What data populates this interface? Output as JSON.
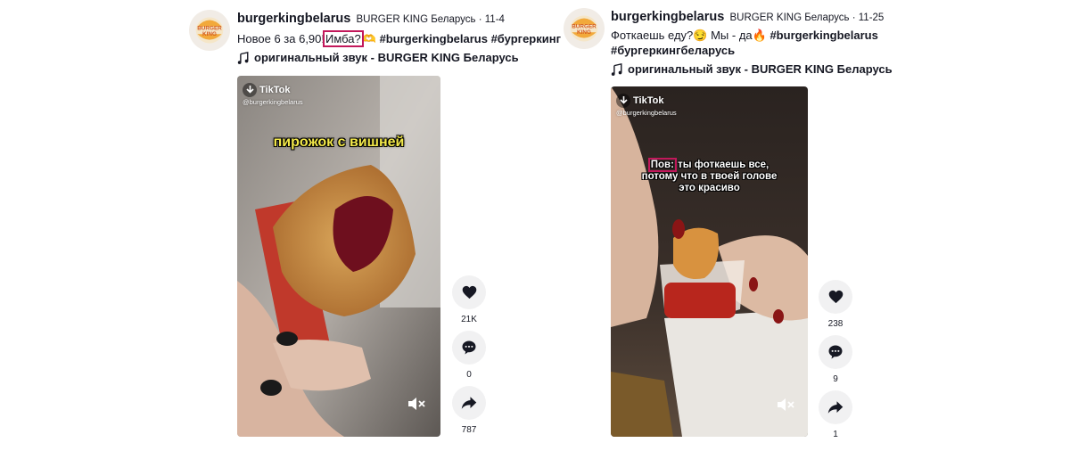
{
  "posts": [
    {
      "username": "burgerkingbelarus",
      "nickname": "BURGER KING Беларусь",
      "date": "11-4",
      "caption_before": "Новое 6 за 6,90!",
      "caption_highlight": "Имба?",
      "caption_emoji": "🫶",
      "hashtags": [
        "#burgerkingbelarus",
        "#бургеркинг"
      ],
      "music": "оригинальный звук - BURGER KING Беларусь",
      "watermark": "TikTok",
      "watermark_handle": "@burgerkingbelarus",
      "overlay_text": "пирожок с вишней",
      "likes": "21K",
      "comments": "0",
      "shares": "787"
    },
    {
      "username": "burgerkingbelarus",
      "nickname": "BURGER KING Беларусь",
      "date": "11-25",
      "caption_text": "Фоткаешь еду?😏 Мы - да🔥",
      "hashtags": [
        "#burgerkingbelarus",
        "#бургеркингбеларусь"
      ],
      "music": "оригинальный звук - BURGER KING Беларусь",
      "watermark": "TikTok",
      "watermark_handle": "@burgerkingbelarus",
      "overlay_highlight": "Пов:",
      "overlay_line1_rest": " ты фоткаешь все,",
      "overlay_line2": "потому что в твоей голове",
      "overlay_line3": "это красиво",
      "likes": "238",
      "comments": "9",
      "shares": "1"
    }
  ],
  "logo_text": [
    "BURGER",
    "KING"
  ],
  "colors": {
    "highlight_box": "#c2185b",
    "bk_orange": "#d35a1f",
    "bk_bun": "#f2a93b",
    "action_bg": "#f1f1f2"
  }
}
